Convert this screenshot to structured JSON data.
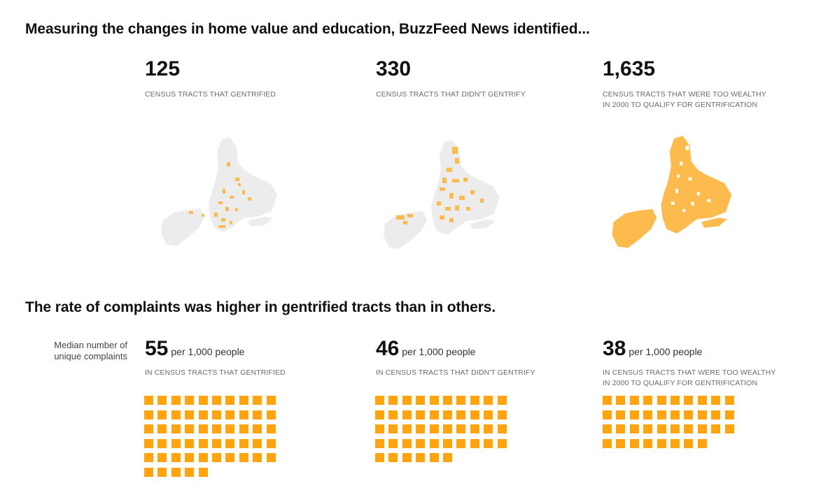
{
  "headline1": "Measuring the changes in home value and education, BuzzFeed News identified...",
  "headline2": "The rate of complaints was higher in gentrified tracts than in others.",
  "stats": [
    {
      "number": "125",
      "label": "CENSUS TRACTS THAT GENTRIFIED",
      "label2": ""
    },
    {
      "number": "330",
      "label": "CENSUS TRACTS THAT DIDN'T GENTRIFY",
      "label2": ""
    },
    {
      "number": "1,635",
      "label": "CENSUS TRACTS THAT WERE TOO WEALTHY",
      "label2": "IN 2000 TO QUALIFY FOR GENTRIFICATION"
    }
  ],
  "side_label": {
    "line1": "Median number of",
    "line2": "unique complaints"
  },
  "rates": [
    {
      "number": "55",
      "unit": "per 1,000 people",
      "label": "IN CENSUS TRACTS THAT GENTRIFIED",
      "label2": "",
      "squares": 55
    },
    {
      "number": "46",
      "unit": "per 1,000 people",
      "label": "IN CENSUS TRACTS THAT DIDN'T GENTRIFY",
      "label2": "",
      "squares": 46
    },
    {
      "number": "38",
      "unit": "per 1,000 people",
      "label": "IN CENSUS TRACTS THAT WERE TOO WEALTHY",
      "label2": "IN 2000 TO QUALIFY FOR GENTRIFICATION",
      "squares": 38
    }
  ],
  "colors": {
    "highlight": "#ffa30f",
    "map_highlight": "#fdba4d",
    "map_base": "#ececec"
  },
  "icons": [
    "nyc-map-gentrified",
    "nyc-map-not-gentrified",
    "nyc-map-too-wealthy",
    "complaint-square"
  ]
}
